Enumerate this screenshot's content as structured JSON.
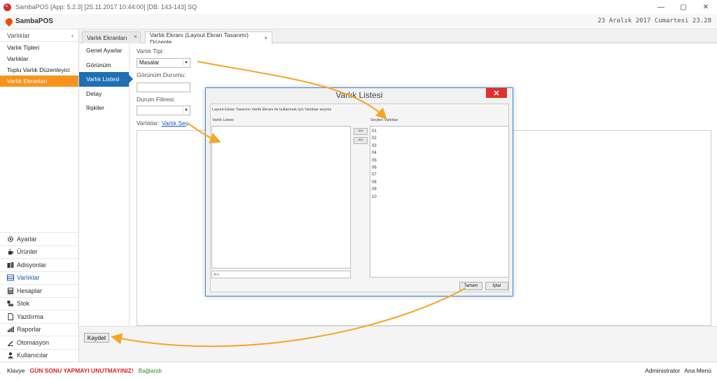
{
  "window": {
    "title": "SambaPOS [App: 5.2.3] [25.11.2017 10:44:00] [DB: 143-143] SQ",
    "minimize": "—",
    "restore": "▢",
    "close": "✕"
  },
  "brand": {
    "name": "SambaPOS",
    "date": "23 Aralık 2017 Cumartesi 23.28"
  },
  "sidebar": {
    "header": "Varlıklar",
    "collapse": "‹",
    "items": [
      {
        "label": "Varlık Tipleri"
      },
      {
        "label": "Varlıklar"
      },
      {
        "label": "Toplu Varlık Düzenleyici"
      },
      {
        "label": "Varlık Ekranları"
      }
    ],
    "active_index": 3,
    "nav": [
      {
        "label": "Ayarlar",
        "icon": "gear-icon"
      },
      {
        "label": "Ürünler",
        "icon": "coffee-cup-icon"
      },
      {
        "label": "Adisyonlar",
        "icon": "tickets-icon"
      },
      {
        "label": "Varlıklar",
        "icon": "table-icon"
      },
      {
        "label": "Hesaplar",
        "icon": "calculator-icon"
      },
      {
        "label": "Stok",
        "icon": "stock-icon"
      },
      {
        "label": "Yazdırma",
        "icon": "document-icon"
      },
      {
        "label": "Raporlar",
        "icon": "bar-chart-icon"
      },
      {
        "label": "Otomasyon",
        "icon": "pen-icon"
      },
      {
        "label": "Kullanıcılar",
        "icon": "user-icon"
      }
    ],
    "nav_active_index": 3
  },
  "tabs": [
    {
      "label": "Varlık Ekranları",
      "close": "×"
    },
    {
      "label": "Varlık Ekranı (Layout Ekran Tasarımı) Düzenle",
      "close": "×"
    }
  ],
  "subnav": {
    "items": [
      {
        "label": "Genel Ayarlar"
      },
      {
        "label": "Görünüm"
      },
      {
        "label": "Varlık Listesi"
      },
      {
        "label": "Detay"
      },
      {
        "label": "İlişkiler"
      }
    ],
    "active_index": 2
  },
  "form": {
    "varlik_tipi_label": "Varlık Tipi:",
    "varlik_tipi_value": "Masalar",
    "gorunum_durumu_label": "Görünüm Durumu:",
    "gorunum_durumu_value": "",
    "durum_filtresi_label": "Durum Filtresi:",
    "durum_filtresi_value": "",
    "varliklar_label": "Varlıklar:",
    "varlik_sec_link": "Varlık Seç"
  },
  "save_button": "Kaydet",
  "statusbar": {
    "keyboard": "Klavye",
    "warning": "GÜN SONU YAPMAYI UNUTMAYINIZ!",
    "connected": "Bağlandı",
    "user": "Administrator",
    "main_menu": "Ana Menü"
  },
  "dialog": {
    "title": "Varlık Listesi",
    "close": "✕",
    "instruction": "Layout Ekran Tasarımı Varlık Ekranı ile kullanmak için Varlıklar seçiniz",
    "left_header": "Varlık Listesi",
    "right_header": "Seçilen Varlıklar",
    "add_all": ">>",
    "remove_all": "<<",
    "search_placeholder": "Ara",
    "selected": [
      "01",
      "02",
      "03",
      "04",
      "05",
      "06",
      "07",
      "08",
      "09",
      "10"
    ],
    "ok_button": "Tamam",
    "cancel_button": "İptal"
  },
  "colors": {
    "accent_orange": "#f7941d",
    "accent_blue": "#1f6fb5",
    "warning_red": "#e02020",
    "ok_green": "#2e8b2e",
    "annotation_arrow": "#f5a623"
  }
}
